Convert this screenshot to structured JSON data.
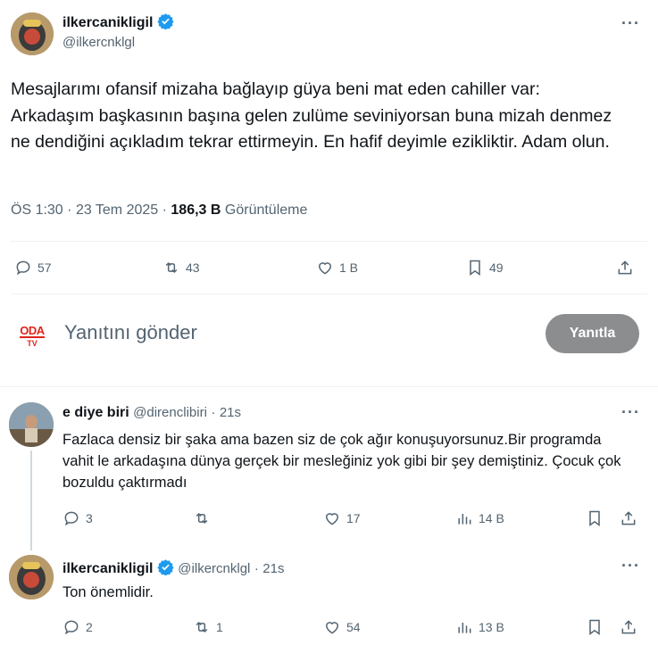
{
  "main_tweet": {
    "display_name": "ilkercanikligil",
    "handle": "@ilkercnklgl",
    "text": "Mesajlarımı ofansif mizaha bağlayıp güya beni mat eden cahiller var: Arkadaşım başkasının başına gelen zulüme seviniyorsan buna mizah denmez ne dendiğini açıkladım tekrar ettirmeyin. En hafif deyimle eziklіktir. Adam olun.",
    "time": "ÖS 1:30",
    "date": "23 Tem 2025",
    "views_count": "186,3 B",
    "views_label": "Görüntüleme",
    "replies": "57",
    "retweets": "43",
    "likes": "1 B",
    "bookmarks": "49"
  },
  "composer": {
    "placeholder": "Yanıtını gönder",
    "button_label": "Yanıtla",
    "avatar_text_top": "ODA",
    "avatar_text_bottom": "TV"
  },
  "replies": [
    {
      "display_name": "e diye biri",
      "handle": "@direnclibiri",
      "time": "21s",
      "text": "Fazlaca densiz bir şaka ama bazen siz de çok ağır konuşuyorsunuz.Bir programda vahit le arkadaşına dünya gerçek bir mesleğiniz yok gibi bir şey demiştiniz. Çocuk çok bozuldu çaktırmadı",
      "replies": "3",
      "retweets": "",
      "likes": "17",
      "views": "14 B"
    },
    {
      "display_name": "ilkercanikligil",
      "handle": "@ilkercnklgl",
      "time": "21s",
      "text": "Ton önemlidir.",
      "replies": "2",
      "retweets": "1",
      "likes": "54",
      "views": "13 B"
    }
  ],
  "colors": {
    "verified": "#1d9bf0",
    "muted": "#536471",
    "button": "#8b8d8f"
  }
}
